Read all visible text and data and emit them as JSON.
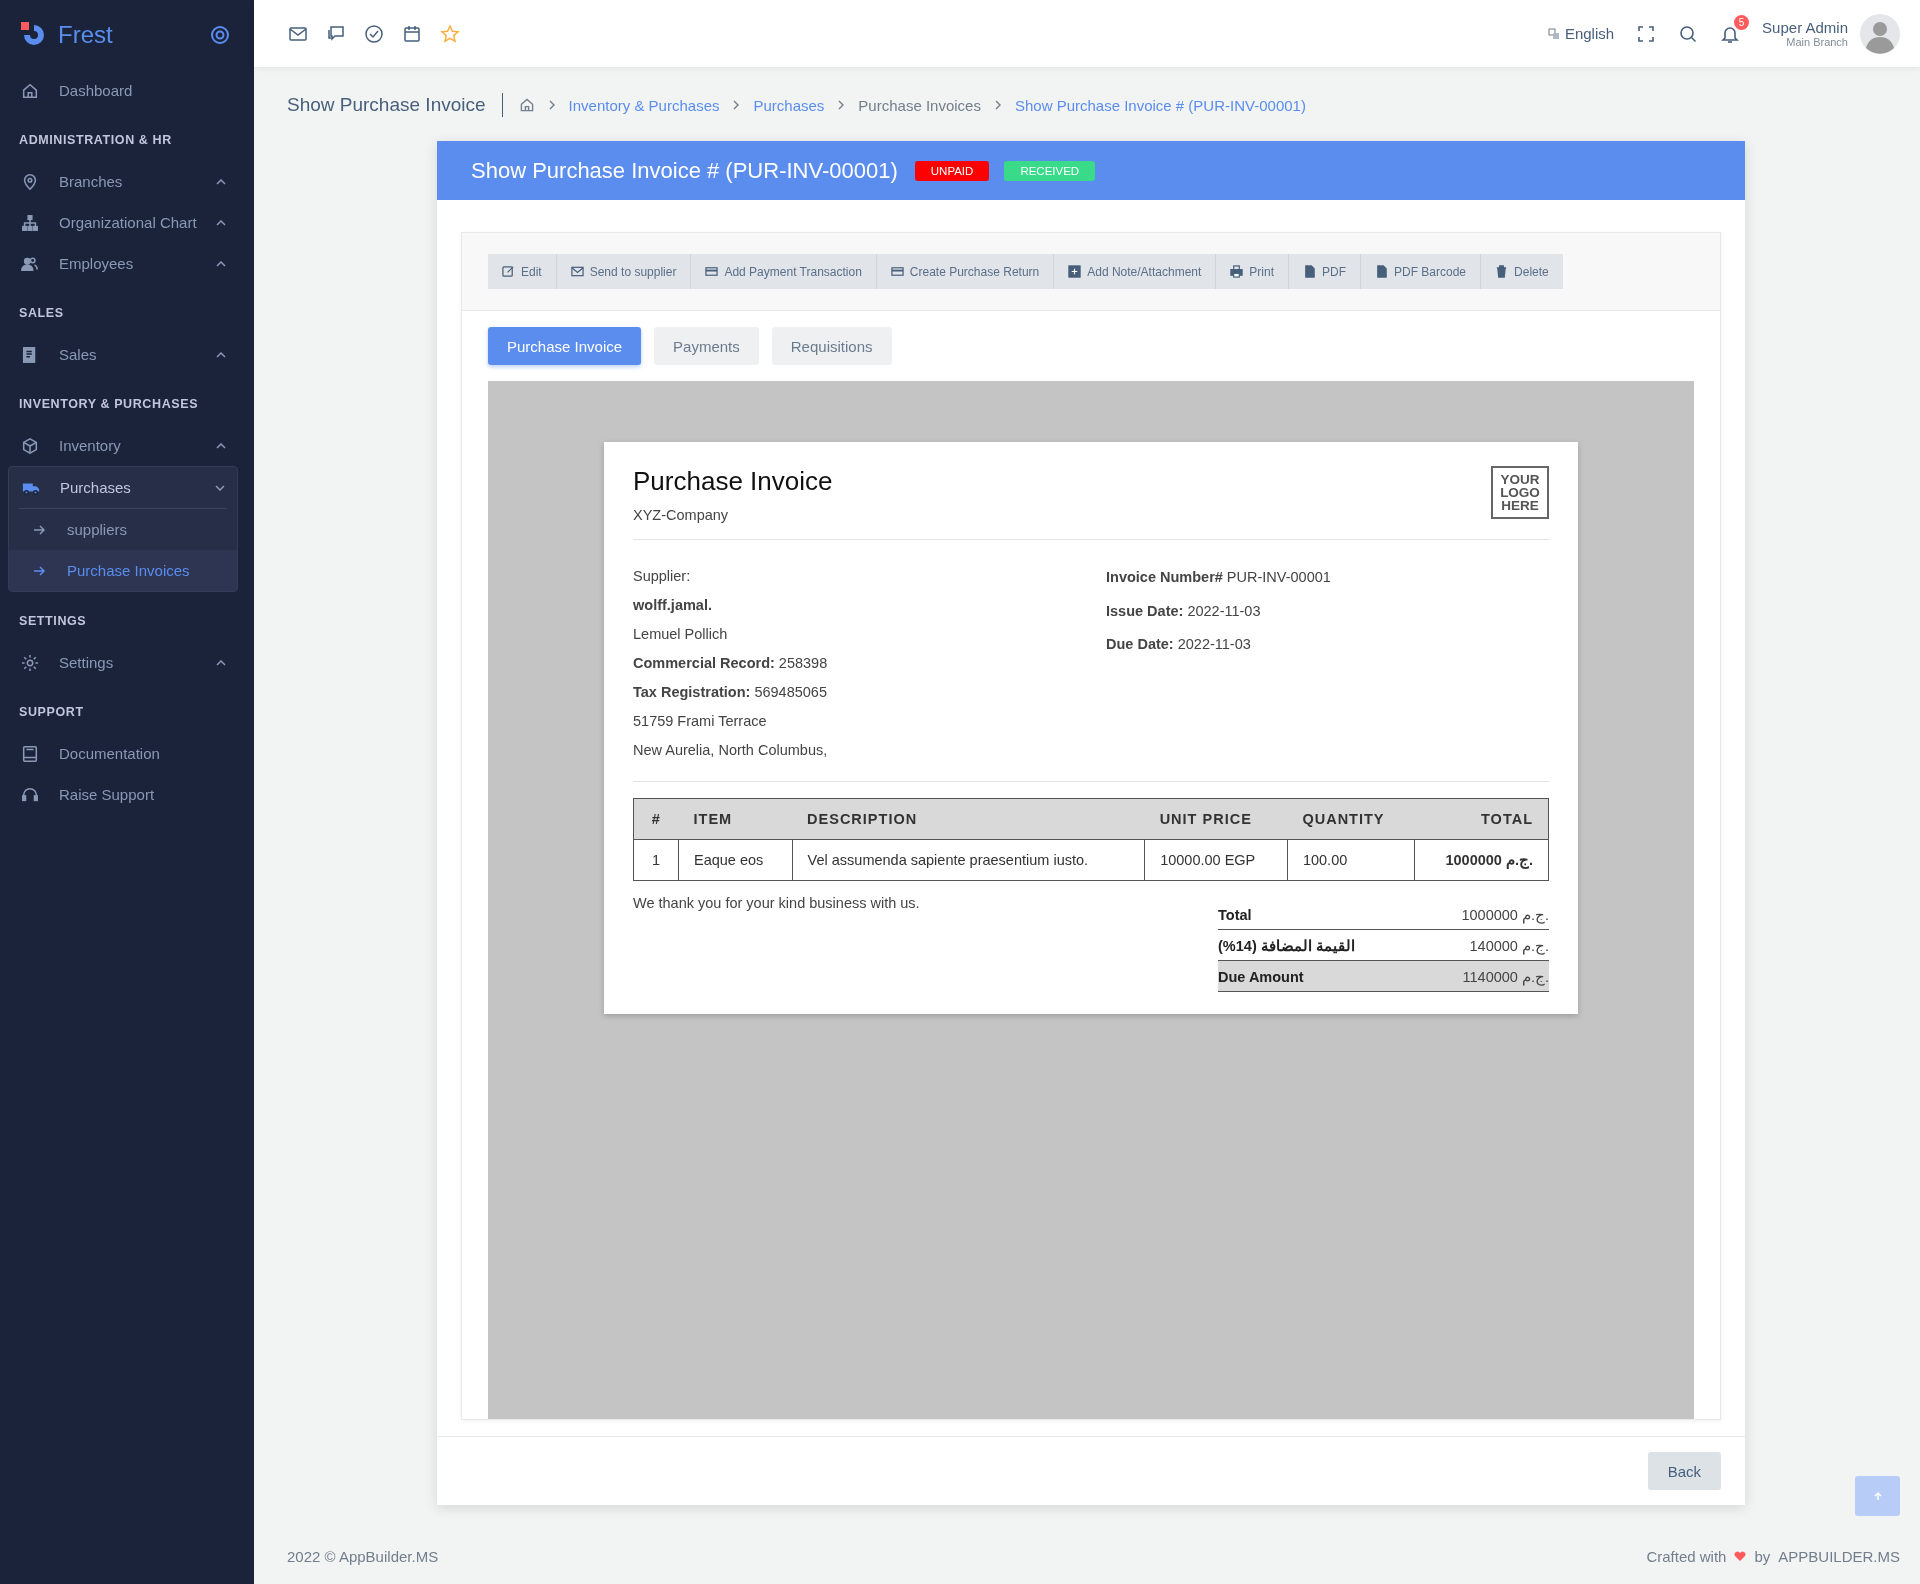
{
  "sidebar": {
    "brand": "Frest",
    "sections": [
      {
        "items": [
          {
            "label": "Dashboard",
            "kind": "home"
          }
        ]
      },
      {
        "title": "ADMINISTRATION & HR",
        "items": [
          {
            "label": "Branches",
            "kind": "pin",
            "expanded": false
          },
          {
            "label": "Organizational Chart",
            "kind": "org",
            "expanded": false
          },
          {
            "label": "Employees",
            "kind": "users",
            "expanded": false
          }
        ]
      },
      {
        "title": "SALES",
        "items": [
          {
            "label": "Sales",
            "kind": "receipt",
            "expanded": false
          }
        ]
      },
      {
        "title": "INVENTORY & PURCHASES",
        "items": [
          {
            "label": "Inventory",
            "kind": "box",
            "expanded": false
          },
          {
            "label": "Purchases",
            "kind": "truck",
            "expanded": true,
            "children": [
              {
                "label": "suppliers",
                "selected": false
              },
              {
                "label": "Purchase Invoices",
                "selected": true
              }
            ]
          }
        ]
      },
      {
        "title": "SETTINGS",
        "items": [
          {
            "label": "Settings",
            "kind": "gear",
            "expanded": false
          }
        ]
      },
      {
        "title": "SUPPORT",
        "items": [
          {
            "label": "Documentation",
            "kind": "book"
          },
          {
            "label": "Raise Support",
            "kind": "headset"
          }
        ]
      }
    ]
  },
  "topbar": {
    "shortcuts": [
      {
        "kind": "mail"
      },
      {
        "kind": "chat"
      },
      {
        "kind": "check"
      },
      {
        "kind": "calendar"
      },
      {
        "kind": "star"
      }
    ],
    "language": "English",
    "notifications": "5",
    "user": {
      "name": "Super Admin",
      "branch": "Main Branch"
    }
  },
  "breadcrumb": {
    "title": "Show Purchase Invoice",
    "items": [
      {
        "label": "Inventory & Purchases",
        "link": true
      },
      {
        "label": "Purchases",
        "link": true
      },
      {
        "label": "Purchase Invoices",
        "link": false
      },
      {
        "label": "Show Purchase Invoice # (PUR-INV-00001)",
        "link": true
      }
    ]
  },
  "card": {
    "title": "Show Purchase Invoice # (PUR-INV-00001)",
    "badges": [
      {
        "label": "UNPAID",
        "color": "#ff0000"
      },
      {
        "label": "RECEIVED",
        "color": "#39da8a"
      }
    ],
    "actions": [
      {
        "label": "Edit",
        "kind": "edit"
      },
      {
        "label": "Send to supplier",
        "kind": "mail"
      },
      {
        "label": "Add Payment Transaction",
        "kind": "card"
      },
      {
        "label": "Create Purchase Return",
        "kind": "card"
      },
      {
        "label": "Add Note/Attachment",
        "kind": "plus"
      },
      {
        "label": "Print",
        "kind": "print"
      },
      {
        "label": "PDF",
        "kind": "file"
      },
      {
        "label": "PDF Barcode",
        "kind": "file"
      },
      {
        "label": "Delete",
        "kind": "trash"
      }
    ],
    "tabs": [
      {
        "label": "Purchase Invoice",
        "selected": true
      },
      {
        "label": "Payments",
        "selected": false
      },
      {
        "label": "Requisitions",
        "selected": false
      }
    ],
    "back": "Back"
  },
  "invoice": {
    "title": "Purchase Invoice",
    "company": "XYZ-Company",
    "logo": "YOUR LOGO HERE",
    "supplier_lines": [
      "Supplier:",
      "**wolff.jamal.**",
      "Lemuel Pollich",
      "**Commercial Record:** 258398",
      "**Tax Registration:** 569485065",
      "51759 Frami Terrace",
      "New Aurelia, North Columbus,"
    ],
    "meta_lines": [
      "**Invoice Number#** PUR-INV-00001",
      "**Issue Date:** 2022-11-03",
      "**Due Date:** 2022-11-03"
    ],
    "columns": [
      "#",
      "ITEM",
      "DESCRIPTION",
      "UNIT PRICE",
      "QUANTITY",
      "TOTAL"
    ],
    "rows": [
      [
        "1",
        "Eaque eos",
        "Vel assumenda sapiente praesentium iusto.",
        "10000.00 EGP",
        "100.00",
        "1000000 ج.م."
      ]
    ],
    "note": "We thank you for your kind business with us.",
    "totals": [
      {
        "label": "Total",
        "value": "1000000 ج.م.",
        "highlighted": false
      },
      {
        "label": "القيمة المضافة (14%)",
        "value": "140000 ج.م.",
        "highlighted": false
      },
      {
        "label": "Due Amount",
        "value": "1140000 ج.م.",
        "highlighted": true
      }
    ]
  },
  "footer": {
    "copyright": "2022 © AppBuilder.MS",
    "crafted": "Crafted with",
    "by": "by",
    "company": "APPBUILDER.MS"
  }
}
